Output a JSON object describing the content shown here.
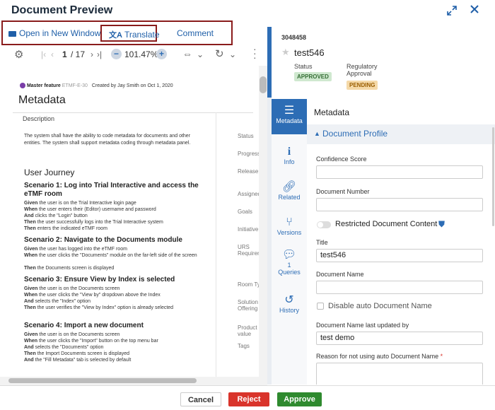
{
  "window": {
    "title": "Document Preview"
  },
  "actions": {
    "open_new_window": "Open in New Window",
    "translate": "Translate",
    "comment": "Comment"
  },
  "viewer": {
    "page_current": "1",
    "page_total": "/ 17",
    "zoom": "101.47%"
  },
  "document": {
    "feature_label": "Master feature",
    "feature_code": "ETMF-E-30",
    "created_by": "Created by Jay Smith on Oct 1, 2020",
    "heading": "Metadata",
    "section": "Description",
    "description": "The system shall have the ability to code metadata for documents and other entities. The system shall support metadata coding through metadata panel.",
    "journey_heading": "User Journey",
    "scenarios": [
      {
        "title": "Scenario 1: Log into Trial Interactive and access the eTMF room",
        "steps": [
          [
            "Given",
            "the user is on the Trial Interactive login page"
          ],
          [
            "When",
            "the user enters their (Editor) username and password"
          ],
          [
            "And",
            "clicks the \"Login\" button"
          ],
          [
            "Then",
            "the user successfully logs into the Trial Interactive system"
          ],
          [
            "Then",
            "enters the indicated eTMF room"
          ]
        ]
      },
      {
        "title": "Scenario 2: Navigate to the Documents module",
        "steps": [
          [
            "Given",
            "the user has logged into the eTMF room"
          ],
          [
            "When",
            "the user clicks the \"Documents\" module on the far-left side of the screen"
          ],
          [
            "Then",
            "the Documents screen is displayed"
          ]
        ]
      },
      {
        "title": "Scenario 3: Ensure View by Index is selected",
        "steps": [
          [
            "Given",
            "the user is on the Documents screen"
          ],
          [
            "When",
            "the user clicks the \"View by\" dropdown above the Index"
          ],
          [
            "And",
            "selects the \"Index\" option"
          ],
          [
            "Then",
            "the user verifies the \"View by Index\" option is already selected"
          ]
        ]
      },
      {
        "title": "Scenario 4: Import a new document",
        "steps": [
          [
            "Given",
            "the user is on the Documents screen"
          ],
          [
            "When",
            "the user clicks the \"Import\" button on the top menu bar"
          ],
          [
            "And",
            "selects the \"Documents\" option"
          ],
          [
            "Then",
            "the Import Documents screen is displayed"
          ],
          [
            "And",
            "the \"Fill Metadata\" tab is selected by default"
          ]
        ]
      }
    ],
    "side_labels": [
      "Status",
      "Progress",
      "Release",
      "Assigned to",
      "Goals",
      "Initiative",
      "URS Requirement",
      "Room Type",
      "Solution Offering",
      "Product value",
      "Tags"
    ]
  },
  "record": {
    "id": "3048458",
    "name": "test546",
    "status_label": "Status",
    "status_value": "APPROVED",
    "regulatory_label": "Regulatory Approval",
    "regulatory_value": "PENDING"
  },
  "tabs": [
    {
      "label": "Metadata",
      "icon": "list-icon"
    },
    {
      "label": "Info",
      "icon": "info-icon"
    },
    {
      "label": "Related",
      "icon": "link-icon"
    },
    {
      "label": "Versions",
      "icon": "branch-icon"
    },
    {
      "label": "Queries",
      "icon": "chat-icon",
      "count": "1"
    },
    {
      "label": "History",
      "icon": "history-icon"
    }
  ],
  "panel": {
    "title": "Metadata",
    "section_title": "Document Profile",
    "confidence_label": "Confidence Score",
    "confidence_value": "",
    "doc_number_label": "Document Number",
    "doc_number_value": "",
    "restricted_label": "Restricted Document Content",
    "title_label": "Title",
    "title_value": "test546",
    "doc_name_label": "Document Name",
    "doc_name_value": "",
    "disable_auto_label": "Disable auto Document Name",
    "name_updated_label": "Document Name last updated by",
    "name_updated_value": "test demo",
    "reason_label": "Reason for not using auto Document Name",
    "required_mark": "*"
  },
  "footer": {
    "cancel": "Cancel",
    "reject": "Reject",
    "approve": "Approve"
  },
  "colors": {
    "accent": "#2d6db5",
    "approve": "#2f8a2f",
    "reject": "#d9342b",
    "highlight": "#8a1c1c"
  }
}
